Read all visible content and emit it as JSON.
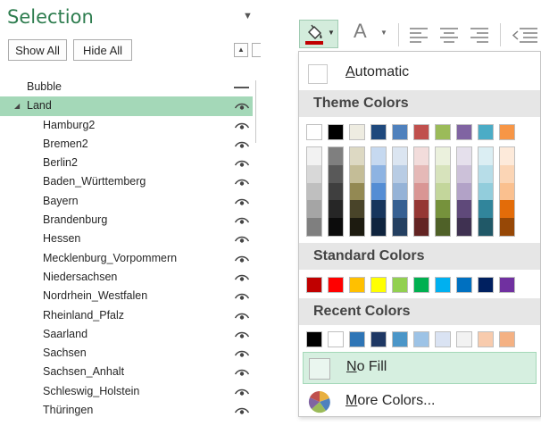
{
  "selection_pane": {
    "title": "Selection",
    "show_all": "Show All",
    "hide_all": "Hide All",
    "items": [
      {
        "label": "Bubble",
        "level": 0,
        "visible_state": "hidden-line",
        "expander": ""
      },
      {
        "label": "Land",
        "level": 0,
        "visible_state": "eye",
        "expander": "◢",
        "selected": true
      },
      {
        "label": "Hamburg2",
        "level": 1,
        "visible_state": "eye"
      },
      {
        "label": "Bremen2",
        "level": 1,
        "visible_state": "eye"
      },
      {
        "label": "Berlin2",
        "level": 1,
        "visible_state": "eye"
      },
      {
        "label": "Baden_Württemberg",
        "level": 1,
        "visible_state": "eye"
      },
      {
        "label": "Bayern",
        "level": 1,
        "visible_state": "eye"
      },
      {
        "label": "Brandenburg",
        "level": 1,
        "visible_state": "eye"
      },
      {
        "label": "Hessen",
        "level": 1,
        "visible_state": "eye"
      },
      {
        "label": "Mecklenburg_Vorpommern",
        "level": 1,
        "visible_state": "eye"
      },
      {
        "label": "Niedersachsen",
        "level": 1,
        "visible_state": "eye"
      },
      {
        "label": "Nordrhein_Westfalen",
        "level": 1,
        "visible_state": "eye"
      },
      {
        "label": "Rheinland_Pfalz",
        "level": 1,
        "visible_state": "eye"
      },
      {
        "label": "Saarland",
        "level": 1,
        "visible_state": "eye"
      },
      {
        "label": "Sachsen",
        "level": 1,
        "visible_state": "eye"
      },
      {
        "label": "Sachsen_Anhalt",
        "level": 1,
        "visible_state": "eye"
      },
      {
        "label": "Schleswig_Holstein",
        "level": 1,
        "visible_state": "eye"
      },
      {
        "label": "Thüringen",
        "level": 1,
        "visible_state": "eye"
      }
    ]
  },
  "ribbon": {
    "font_color_glyph": "A",
    "fill_color_bar": "#c00000"
  },
  "fill_menu": {
    "automatic": "Automatic",
    "theme_colors_head": "Theme Colors",
    "theme_colors": [
      "#ffffff",
      "#000000",
      "#eeece1",
      "#1f497d",
      "#4f81bd",
      "#c0504d",
      "#9bbb59",
      "#8064a2",
      "#4bacc6",
      "#f79646"
    ],
    "theme_shades": [
      [
        "#f2f2f2",
        "#d8d8d8",
        "#bfbfbf",
        "#a5a5a5",
        "#7f7f7f"
      ],
      [
        "#7f7f7f",
        "#595959",
        "#3f3f3f",
        "#262626",
        "#0c0c0c"
      ],
      [
        "#ddd9c3",
        "#c4bd97",
        "#938953",
        "#494429",
        "#1d1b10"
      ],
      [
        "#c6d9f0",
        "#8db3e2",
        "#548dd4",
        "#17365d",
        "#0f243e"
      ],
      [
        "#dbe5f1",
        "#b8cce4",
        "#95b3d7",
        "#366092",
        "#244061"
      ],
      [
        "#f2dcdb",
        "#e5b9b7",
        "#d99694",
        "#953734",
        "#632423"
      ],
      [
        "#ebf1dd",
        "#d7e3bc",
        "#c3d69b",
        "#76923c",
        "#4f6128"
      ],
      [
        "#e5e0ec",
        "#ccc1d9",
        "#b2a2c7",
        "#5f497a",
        "#3f3151"
      ],
      [
        "#dbeef3",
        "#b7dde8",
        "#92cddc",
        "#31859b",
        "#205867"
      ],
      [
        "#fdeada",
        "#fbd5b5",
        "#fac08f",
        "#e36c09",
        "#974806"
      ]
    ],
    "standard_colors_head": "Standard Colors",
    "standard_colors": [
      "#c00000",
      "#ff0000",
      "#ffc000",
      "#ffff00",
      "#92d050",
      "#00b050",
      "#00b0f0",
      "#0070c0",
      "#002060",
      "#7030a0"
    ],
    "recent_colors_head": "Recent Colors",
    "recent_colors": [
      "#000000",
      "#ffffff",
      "#2e75b6",
      "#1f3864",
      "#4b96c8",
      "#9dc3e6",
      "#dae3f3",
      "#f2f2f2",
      "#f8cbad",
      "#f4b183"
    ],
    "no_fill": "No Fill",
    "more_colors": "More Colors..."
  }
}
